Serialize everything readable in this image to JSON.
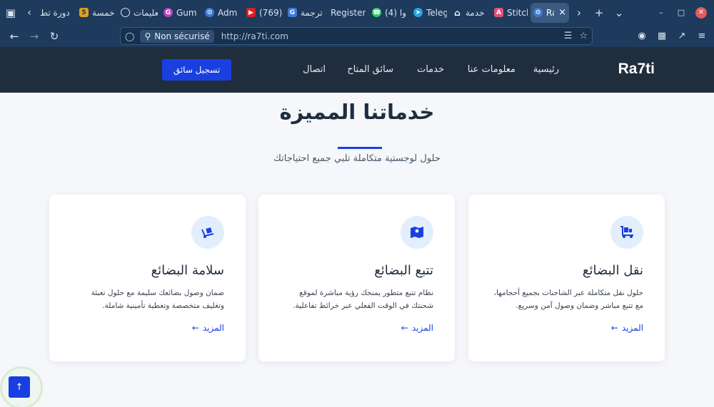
{
  "browser": {
    "tabs": [
      {
        "label": "دورة تط",
        "icon": "none",
        "color": "#1e3a5c"
      },
      {
        "label": "خمسة",
        "icon": "k-icon",
        "color": "#e0a020"
      },
      {
        "label": "تعليمات",
        "icon": "openai-icon",
        "color": "#1e3a5c"
      },
      {
        "label": "Gum",
        "icon": "g-icon",
        "color": "#c040c0"
      },
      {
        "label": "Adm",
        "icon": "gear-icon",
        "color": "#3a7bd5"
      },
      {
        "label": "(769)",
        "icon": "youtube-icon",
        "color": "#e02020"
      },
      {
        "label": "ترجمة",
        "icon": "translate-icon",
        "color": "#3a7bd5"
      },
      {
        "label": "Register",
        "icon": "none",
        "color": "#1e3a5c"
      },
      {
        "label": "(4) وا",
        "icon": "whatsapp-icon",
        "color": "#25d366"
      },
      {
        "label": "Teleg",
        "icon": "telegram-icon",
        "color": "#2aa3e0"
      },
      {
        "label": "خدمة",
        "icon": "home-icon",
        "color": "#1e3a5c"
      },
      {
        "label": "Stitch",
        "icon": "stitch-icon",
        "color": "#e0507a"
      }
    ],
    "active_tab": {
      "label": "Ra",
      "close": "×"
    },
    "url_bar": {
      "security_label": "Non sécurisé",
      "url": "http://ra7ti.com"
    }
  },
  "site": {
    "brand": "Ra7ti",
    "menu": [
      "رئيسية",
      "معلومات عنا",
      "خدمات",
      "سائق المتاح",
      "اتصال"
    ],
    "cta_label": "تسجيل سائق"
  },
  "section": {
    "title": "خدماتنا المميزة",
    "subtitle": "حلول لوجستية متكاملة تلبي جميع احتياجاتك"
  },
  "cards": [
    {
      "title": "نقل البضائع",
      "icon": "truck-loading-icon",
      "desc_line1": "حلول نقل متكاملة عبر الشاحنات بجميع أحجامها،",
      "desc_line2": "مع تتبع مباشر وضمان وصول آمن وسريع.",
      "more": "المزيد"
    },
    {
      "title": "تتبع البضائع",
      "icon": "map-icon",
      "desc_line1": "نظام تتبع متطور يمنحك رؤية مباشرة لموقع",
      "desc_line2": "شحنتك في الوقت الفعلي عبر خرائط تفاعلية.",
      "more": "المزيد"
    },
    {
      "title": "سلامة البضائع",
      "icon": "dolly-icon",
      "desc_line1": "ضمان وصول بضائعك سليمة مع حلول تعبئة",
      "desc_line2": "وتغليف متخصصة وتغطية تأمينية شاملة.",
      "more": "المزيد"
    }
  ],
  "colors": {
    "accent": "#1a3fe0",
    "header_bg": "#1f2d3d",
    "browser_bg": "#1e3a5c",
    "icon_bg": "#e2eefb"
  }
}
